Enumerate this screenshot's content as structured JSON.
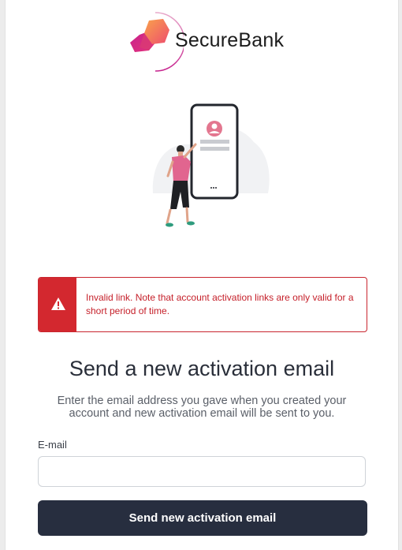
{
  "brand": {
    "name": "SecureBank"
  },
  "alert": {
    "message": "Invalid link. Note that account activation links are only valid for a short period of time.",
    "icon": "warning-icon",
    "color": "#d3282f"
  },
  "form": {
    "title": "Send a new activation email",
    "description": "Enter the email address you gave when you created your account and new activation email will be sent to you.",
    "email_label": "E-mail",
    "email_value": "",
    "email_placeholder": "",
    "submit_label": "Send new activation email"
  },
  "colors": {
    "primary_button": "#272e3f",
    "error": "#c51f29",
    "brand_pink": "#d6337a",
    "brand_orange": "#f47c4c"
  }
}
